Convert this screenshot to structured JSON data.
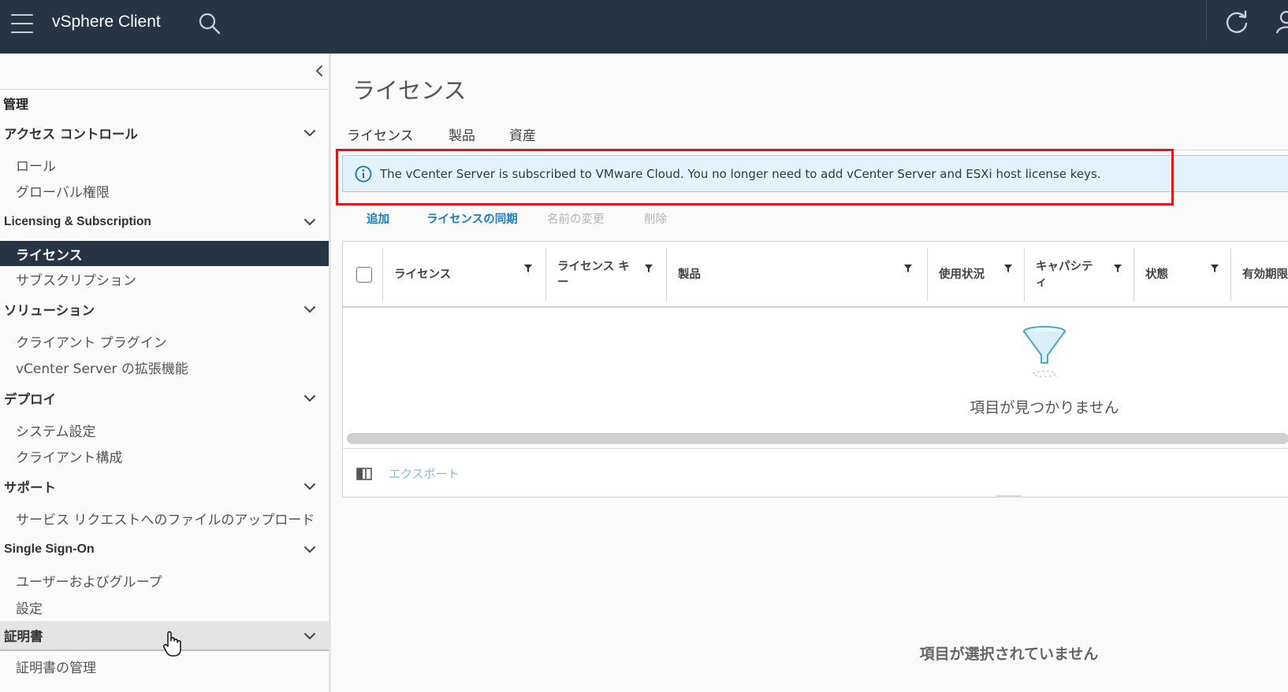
{
  "app": {
    "title": "vSphere Client"
  },
  "sidebar": {
    "heading": "管理",
    "groups": [
      {
        "label": "アクセス コントロール",
        "items": [
          "ロール",
          "グローバル権限"
        ]
      },
      {
        "label": "Licensing & Subscription",
        "items": [
          "ライセンス",
          "サブスクリプション"
        ]
      },
      {
        "label": "ソリューション",
        "items": [
          "クライアント プラグイン",
          "vCenter Server の拡張機能"
        ]
      },
      {
        "label": "デプロイ",
        "items": [
          "システム設定",
          "クライアント構成"
        ]
      },
      {
        "label": "サポート",
        "items": [
          "サービス リクエストへのファイルのアップロード"
        ]
      },
      {
        "label": "Single Sign-On",
        "items": [
          "ユーザーおよびグループ",
          "設定"
        ]
      },
      {
        "label": "証明書",
        "items": [
          "証明書の管理"
        ]
      }
    ]
  },
  "main": {
    "title": "ライセンス",
    "tabs": [
      "ライセンス",
      "製品",
      "資産"
    ],
    "active_tab": "ライセンス",
    "alert": "The vCenter Server is subscribed to VMware Cloud. You no longer need to add vCenter Server and ESXi host license keys.",
    "actions": {
      "add": "追加",
      "sync": "ライセンスの同期",
      "rename": "名前の変更",
      "delete": "削除"
    },
    "columns": {
      "license": "ライセンス",
      "license_key_1": "ライセンス キ",
      "license_key_2": "ー",
      "product": "製品",
      "usage": "使用状況",
      "capacity_1": "キャパシテ",
      "capacity_2": "ィ",
      "state": "状態",
      "expiration": "有効期限"
    },
    "empty_message": "項目が見つかりません",
    "export_label": "エクスポート",
    "detail_empty": "項目が選択されていません"
  },
  "colors": {
    "topbar": "#253545",
    "active_item": "#253545",
    "alert_bg": "#e3f3fb",
    "highlight": "#e0161b",
    "link": "#1b7cc3"
  }
}
